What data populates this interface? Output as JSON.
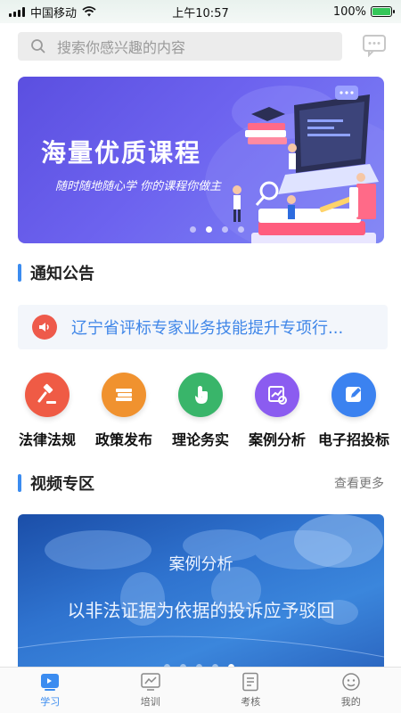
{
  "status_bar": {
    "carrier": "中国移动",
    "time": "上午10:57",
    "battery_pct": "100%",
    "battery_level": 1.0
  },
  "search": {
    "placeholder": "搜索你感兴趣的内容"
  },
  "banner": {
    "title": "海量优质课程",
    "subtitle": "随时随地随心学 你的课程你做主",
    "slide_count": 4,
    "active_slide": 2
  },
  "notice_section": {
    "title": "通知公告",
    "text": "辽宁省评标专家业务技能提升专项行..."
  },
  "categories": [
    {
      "label": "法律法规",
      "icon": "gavel-icon",
      "color": "#ef5b45"
    },
    {
      "label": "政策发布",
      "icon": "books-icon",
      "color": "#f0922f"
    },
    {
      "label": "理论务实",
      "icon": "touch-icon",
      "color": "#39b56a"
    },
    {
      "label": "案例分析",
      "icon": "chart-icon",
      "color": "#8b5cf0"
    },
    {
      "label": "电子招投标",
      "icon": "edit-icon",
      "color": "#3b82f0"
    }
  ],
  "video_section": {
    "title": "视频专区",
    "more": "查看更多",
    "card_title": "案例分析",
    "card_subtitle": "以非法证据为依据的投诉应予驳回",
    "slide_count": 5,
    "active_slide": 5
  },
  "tabbar": {
    "items": [
      {
        "label": "学习",
        "icon": "study-icon",
        "active": true
      },
      {
        "label": "培训",
        "icon": "training-icon",
        "active": false
      },
      {
        "label": "考核",
        "icon": "exam-icon",
        "active": false
      },
      {
        "label": "我的",
        "icon": "profile-icon",
        "active": false
      }
    ]
  },
  "colors": {
    "accent": "#3b8cf0",
    "notice_icon": "#ee5a4b",
    "notice_text": "#3f86e8"
  }
}
